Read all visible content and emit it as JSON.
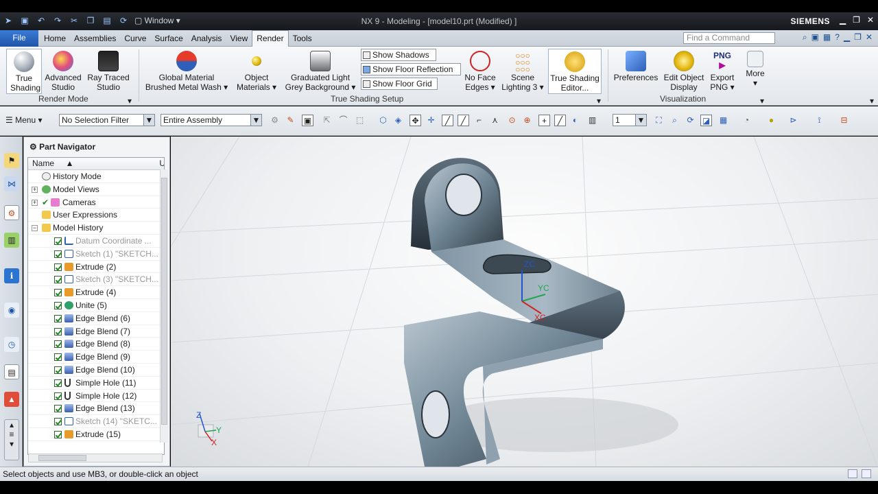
{
  "titlebar": {
    "title": "NX 9 - Modeling - [model10.prt (Modified) ]",
    "brand": "SIEMENS",
    "window_menu": "Window"
  },
  "menubar": {
    "file": "File",
    "tabs": [
      "Home",
      "Assemblies",
      "Curve",
      "Surface",
      "Analysis",
      "View",
      "Render",
      "Tools"
    ],
    "active_tab": "Render",
    "find_placeholder": "Find a Command"
  },
  "ribbon": {
    "render_mode": {
      "group_label": "Render Mode",
      "true_shading": "True Shading",
      "advanced_studio": "Advanced Studio",
      "ray_traced_studio": "Ray Traced Studio"
    },
    "true_shading_setup": {
      "group_label": "True Shading Setup",
      "global_material_1": "Global Material",
      "global_material_2": "Brushed Metal Wash",
      "object_materials_1": "Object",
      "object_materials_2": "Materials",
      "background_1": "Graduated Light",
      "background_2": "Grey Background",
      "show_shadows": "Show Shadows",
      "show_floor_reflection": "Show Floor Reflection",
      "show_floor_grid": "Show Floor Grid",
      "no_face_edges_1": "No Face",
      "no_face_edges_2": "Edges",
      "scene_lighting_1": "Scene",
      "scene_lighting_2": "Lighting 3",
      "editor_1": "True Shading",
      "editor_2": "Editor..."
    },
    "visualization": {
      "group_label": "Visualization",
      "preferences": "Preferences",
      "edit_object_display_1": "Edit Object",
      "edit_object_display_2": "Display",
      "export_png_1": "Export",
      "export_png_2": "PNG",
      "png_badge": "PNG",
      "more": "More"
    }
  },
  "toolbar": {
    "menu": "Menu",
    "selection_filter": "No Selection Filter",
    "scope": "Entire Assembly",
    "layer": "1"
  },
  "navigator": {
    "title": "Part Navigator",
    "column": "Name",
    "column2": "U",
    "items": [
      {
        "label": "History Mode"
      },
      {
        "label": "Model Views"
      },
      {
        "label": "Cameras"
      },
      {
        "label": "User Expressions"
      },
      {
        "label": "Model History"
      },
      {
        "label": "Datum Coordinate ..."
      },
      {
        "label": "Sketch (1) \"SKETCH..."
      },
      {
        "label": "Extrude (2)"
      },
      {
        "label": "Sketch (3) \"SKETCH..."
      },
      {
        "label": "Extrude (4)"
      },
      {
        "label": "Unite (5)"
      },
      {
        "label": "Edge Blend (6)"
      },
      {
        "label": "Edge Blend (7)"
      },
      {
        "label": "Edge Blend (8)"
      },
      {
        "label": "Edge Blend (9)"
      },
      {
        "label": "Edge Blend (10)"
      },
      {
        "label": "Simple Hole (11)"
      },
      {
        "label": "Simple Hole (12)"
      },
      {
        "label": "Edge Blend (13)"
      },
      {
        "label": "Sketch (14) \"SKETC..."
      },
      {
        "label": "Extrude (15)"
      }
    ]
  },
  "viewport": {
    "axes": {
      "x": "X",
      "y": "Y",
      "z": "Z"
    },
    "csys": {
      "x": "XC",
      "y": "YC",
      "z": "ZC"
    }
  },
  "status": {
    "message": "Select objects and use MB3, or double-click an object"
  },
  "colors": {
    "accent": "#1f55a8",
    "model": "#6f8594"
  }
}
